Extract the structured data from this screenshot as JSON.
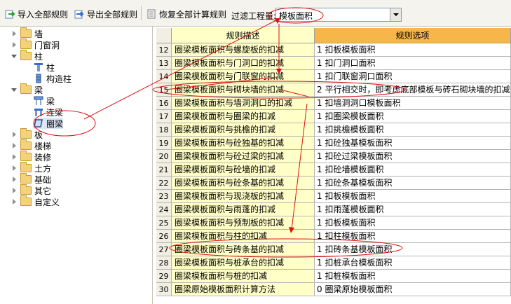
{
  "toolbar": {
    "import_label": "导入全部规则",
    "export_label": "导出全部规则",
    "restore_label": "恢复全部计算规则",
    "filter_label": "过滤工程量:",
    "filter_value": "模板面积"
  },
  "tree": {
    "items": [
      {
        "label": "墙"
      },
      {
        "label": "门窗洞"
      },
      {
        "label": "柱"
      },
      {
        "label": "柱"
      },
      {
        "label": "构造柱"
      },
      {
        "label": "梁"
      },
      {
        "label": "梁"
      },
      {
        "label": "连梁"
      },
      {
        "label": "圈梁"
      },
      {
        "label": "板"
      },
      {
        "label": "楼梯"
      },
      {
        "label": "装修"
      },
      {
        "label": "土方"
      },
      {
        "label": "基础"
      },
      {
        "label": "其它"
      },
      {
        "label": "自定义"
      }
    ]
  },
  "grid": {
    "header_desc": "规则描述",
    "header_opt": "规则选项",
    "rows": [
      {
        "num": "12",
        "desc": "圈梁模板面积与螺旋板的扣减",
        "opt": "1 扣板模板面积"
      },
      {
        "num": "13",
        "desc": "圈梁模板面积与门洞口的扣减",
        "opt": "1 扣门洞口面积"
      },
      {
        "num": "14",
        "desc": "圈梁模板面积与门联窗的扣减",
        "opt": "1 扣门联窗洞口面积"
      },
      {
        "num": "15",
        "desc": "圈梁模板面积与砌块墙的扣减",
        "opt": "2 平行相交时，即考虑底部模板与砖石砌块墙的扣减"
      },
      {
        "num": "16",
        "desc": "圈梁模板面积与墙洞洞口的扣减",
        "opt": "1 扣墙洞洞口模板面积"
      },
      {
        "num": "17",
        "desc": "圈梁模板面积与圈梁的扣减",
        "opt": "1  扣圈梁模板面积"
      },
      {
        "num": "18",
        "desc": "圈梁模板面积与挑檐的扣减",
        "opt": "1 扣挑檐模板面积"
      },
      {
        "num": "19",
        "desc": "圈梁模板面积与砼独基的扣减",
        "opt": "1 扣砼独基模板面积"
      },
      {
        "num": "20",
        "desc": "圈梁模板面积与砼过梁的扣减",
        "opt": "1 扣砼过梁模板面积"
      },
      {
        "num": "21",
        "desc": "圈梁模板面积与砼墙的扣减",
        "opt": "1 扣砼墙模板面积"
      },
      {
        "num": "22",
        "desc": "圈梁模板面积与砼条基的扣减",
        "opt": "1 扣砼条基模板面积"
      },
      {
        "num": "23",
        "desc": "圈梁模板面积与现浇板的扣减",
        "opt": "1 扣板模板面积"
      },
      {
        "num": "24",
        "desc": "圈梁模板面积与雨蓬的扣减",
        "opt": "1 扣雨蓬模板面积"
      },
      {
        "num": "25",
        "desc": "圈梁模板面积与预制板的扣减",
        "opt": "1 扣板模板面积"
      },
      {
        "num": "26",
        "desc": "圈梁模板面积与柱的扣减",
        "opt": "1 扣柱模板面积"
      },
      {
        "num": "27",
        "desc": "圈梁模板面积与砖条基的扣减",
        "opt": "1 扣砖条基模板面积"
      },
      {
        "num": "28",
        "desc": "圈梁模板面积与桩承台的扣减",
        "opt": "1 扣桩承台模板面积"
      },
      {
        "num": "29",
        "desc": "圈梁模板面积与桩的扣减",
        "opt": "1 扣桩模板面积"
      },
      {
        "num": "30",
        "desc": "圈梁原始模板面积计算方法",
        "opt": "0 圈梁原始模板面积"
      }
    ]
  },
  "colors": {
    "header_desc_bg": "#ffffc8",
    "header_opt_bg": "#f7b64a",
    "desc_col_bg": "#ffffc8",
    "annotation": "#e01010"
  }
}
